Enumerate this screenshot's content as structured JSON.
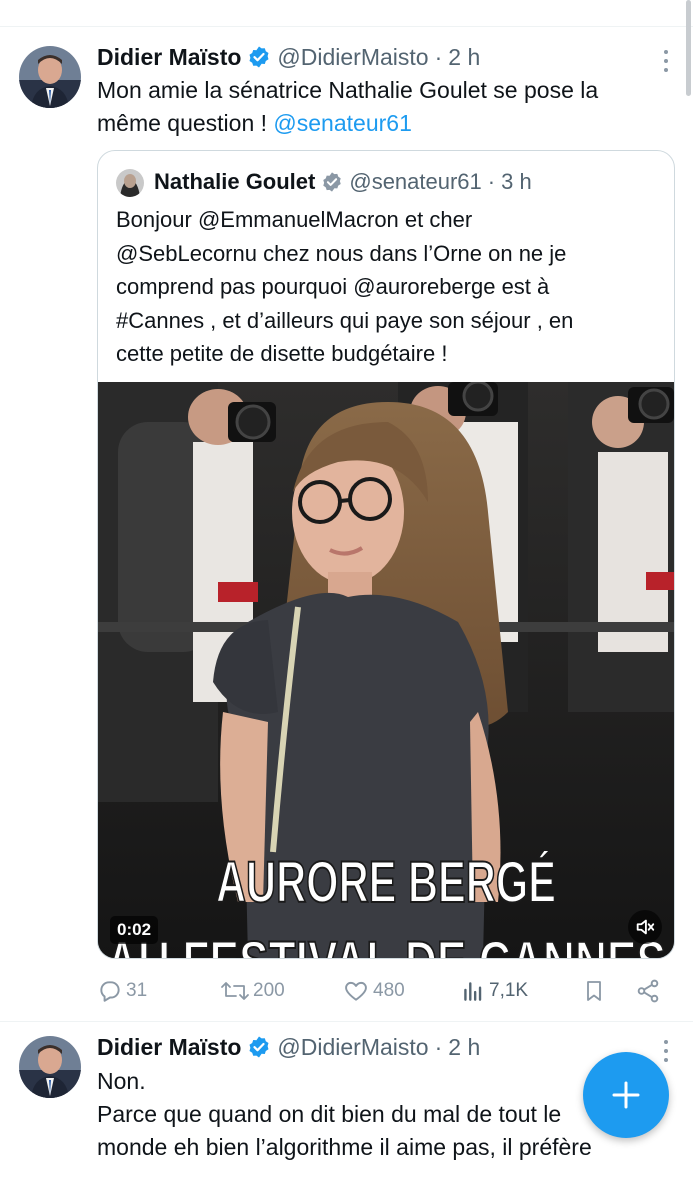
{
  "tweets": [
    {
      "author": "Didier Maïsto",
      "handle": "@DidierMaisto",
      "dot": "·",
      "time": "2 h",
      "text_lines": [
        "Mon amie la sénatrice Nathalie Goulet se pose la",
        "même question ! "
      ],
      "mention": "@senateur61",
      "quote": {
        "author": "Nathalie Goulet",
        "handle": "@senateur61",
        "dot": "·",
        "time": "3 h",
        "lines": [
          "Bonjour @EmmanuelMacron et cher",
          "@SebLecornu chez nous dans l’Orne on ne  je",
          "comprend pas pourquoi @auroreberge est à",
          "#Cannes , et d’ailleurs qui paye son séjour , en",
          "cette petite de disette budgétaire !"
        ],
        "media": {
          "caption_line1": "AURORE BERGÉ",
          "caption_line2": "AU FESTIVAL DE CANNES",
          "timecode": "0:02",
          "mute_icon": "speaker-muted-icon"
        }
      },
      "actions": {
        "replies": "31",
        "retweets": "200",
        "likes": "480",
        "views": "7,1K"
      }
    },
    {
      "author": "Didier Maïsto",
      "handle": "@DidierMaisto",
      "dot": "·",
      "time": "2 h",
      "text_lines": [
        "Non.",
        "Parce que quand on dit bien du mal de tout le",
        "monde eh bien l’algorithme il aime pas, il préfère"
      ]
    }
  ],
  "colors": {
    "accent": "#1d9bf0",
    "muted_text": "#536471",
    "icon_gray": "#8b98a5",
    "border": "#cfd9de"
  },
  "fab": {
    "icon": "plus-icon"
  }
}
